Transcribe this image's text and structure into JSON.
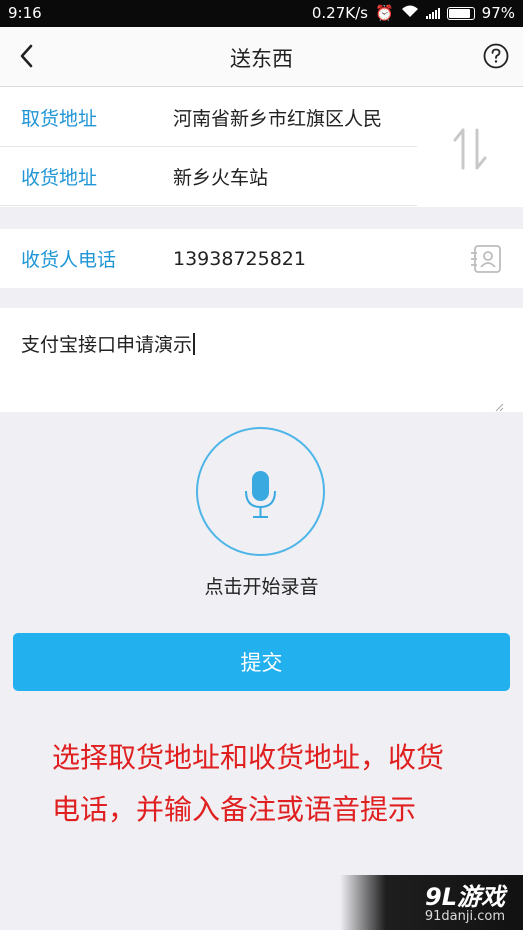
{
  "status_bar": {
    "time": "9:16",
    "network_speed": "0.27K/s",
    "battery": "97%"
  },
  "header": {
    "title": "送东西",
    "back_icon": "back-arrow-icon",
    "help_icon": "help-circle-icon"
  },
  "address": {
    "pickup_label": "取货地址",
    "pickup_value": "河南省新乡市红旗区人民",
    "delivery_label": "收货地址",
    "delivery_value": "新乡火车站",
    "swap_icon": "swap-vertical-icon"
  },
  "phone": {
    "label": "收货人电话",
    "value": "13938725821",
    "contact_icon": "contact-book-icon"
  },
  "note": {
    "value": "支付宝接口申请演示"
  },
  "voice": {
    "label": "点击开始录音",
    "icon": "microphone-icon"
  },
  "submit_label": "提交",
  "instruction": {
    "line1": "选择取货地址和收货地址，收货",
    "line2": "电话，并输入备注或语音提示"
  },
  "watermark": {
    "logo": "9L游戏",
    "url": "91danji.com"
  },
  "colors": {
    "accent": "#2196d6",
    "button": "#22b0ef",
    "mic_ring": "#4db5e8",
    "instruction": "#e02020",
    "background": "#efeff4"
  }
}
